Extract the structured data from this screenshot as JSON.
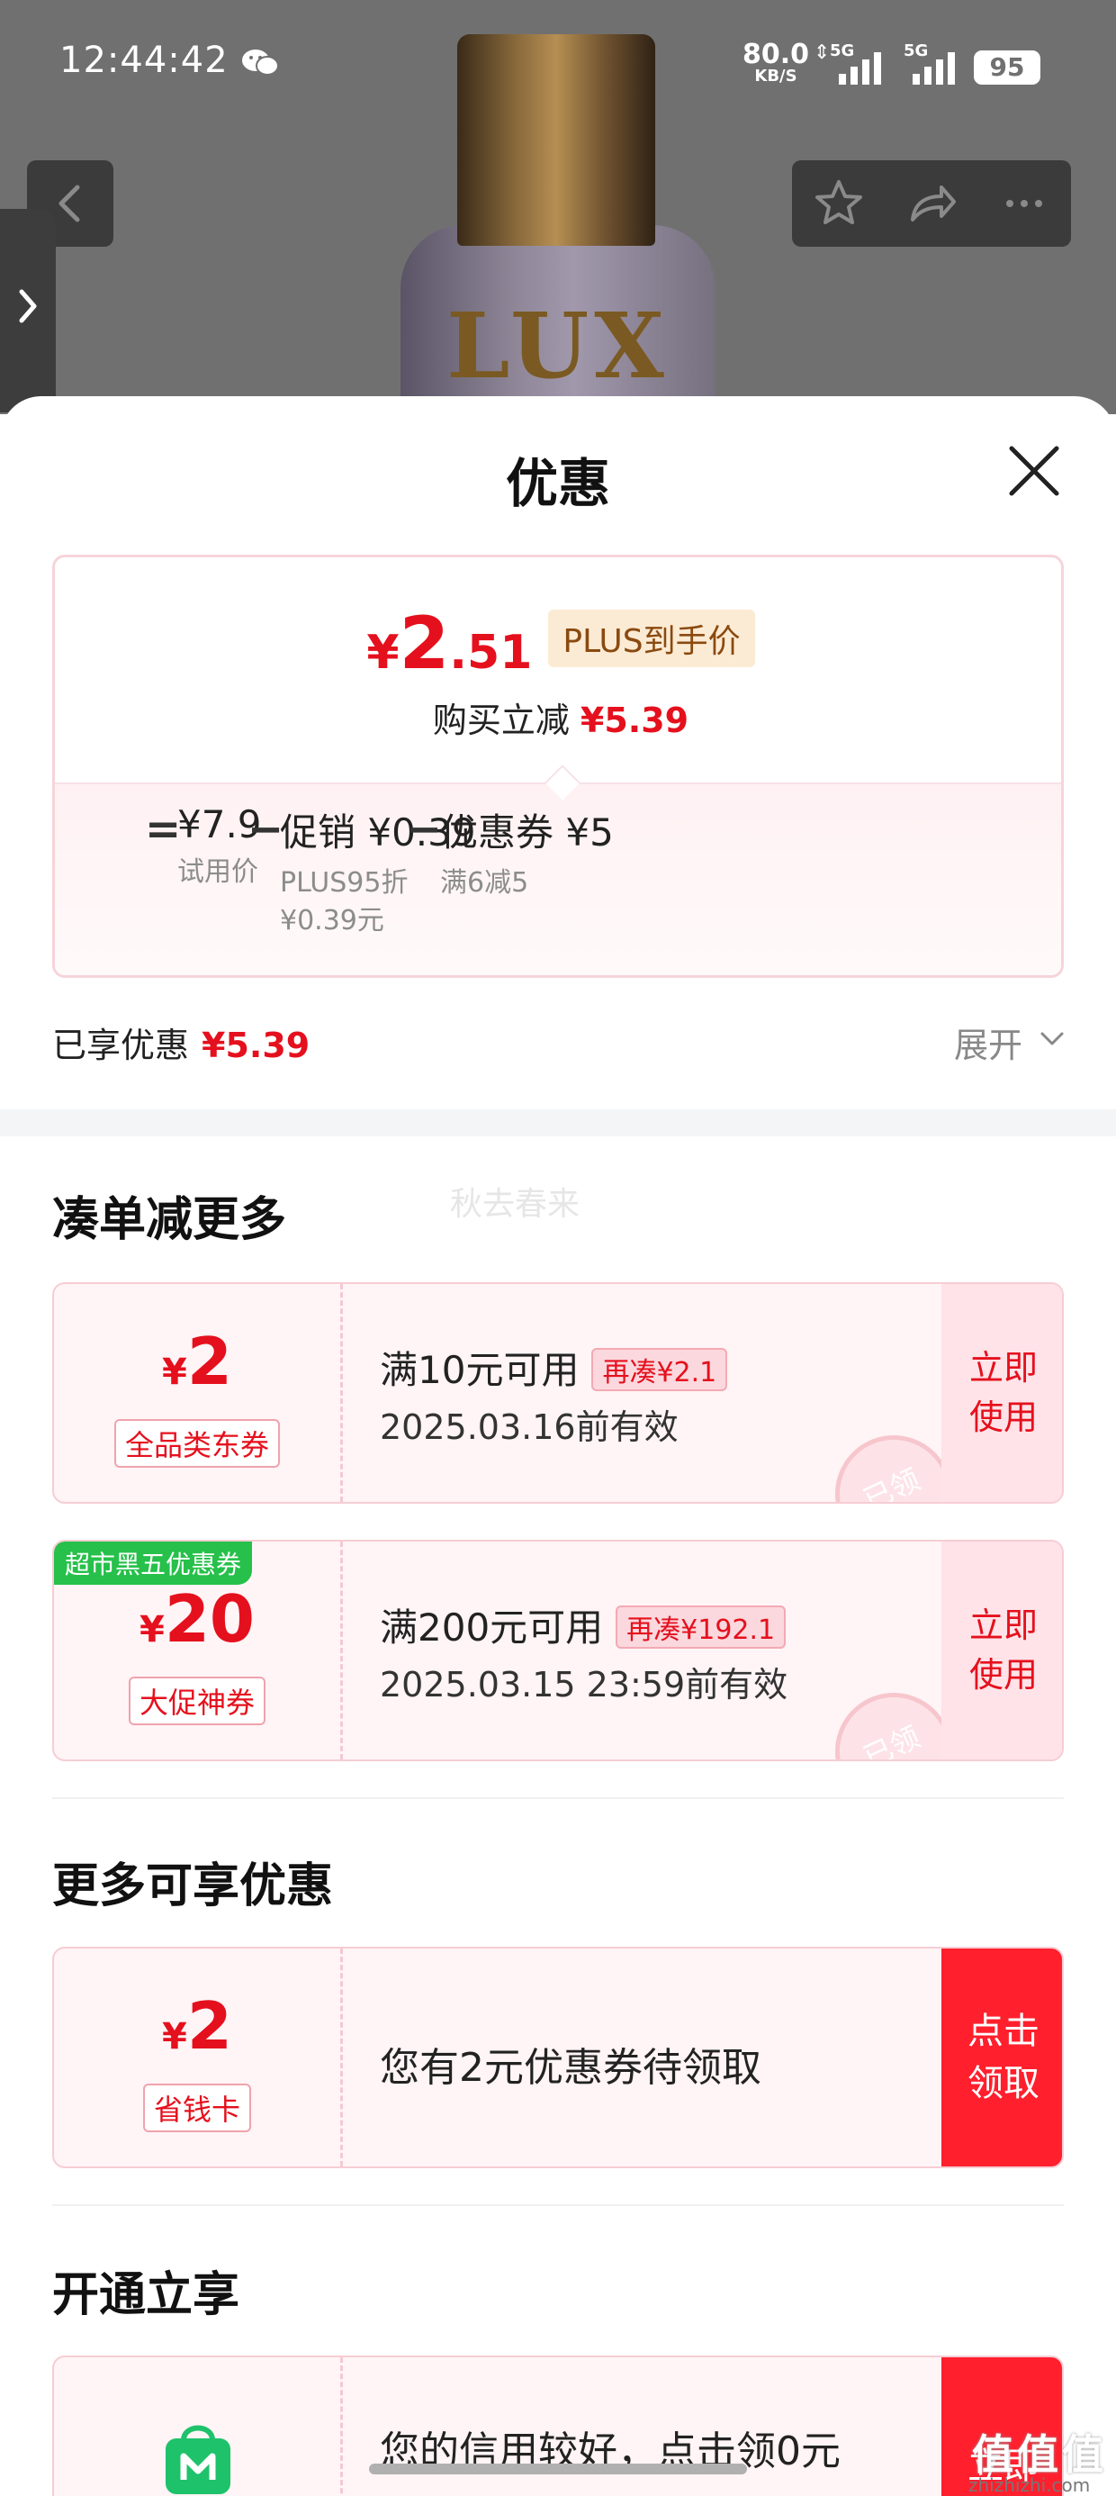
{
  "status_bar": {
    "time": "12:44:42",
    "speed_value": "80.0",
    "speed_unit": "KB/S",
    "network_label_1": "5G",
    "network_label_2": "5G",
    "battery": "95"
  },
  "product": {
    "logo_text": "LUX"
  },
  "sheet": {
    "title": "优惠",
    "price_card": {
      "currency": "¥",
      "price_integer": "2",
      "price_decimal": ".51",
      "plus_tag": "PLUS到手价",
      "instant_cut_label": "购买立减",
      "instant_cut_value": "¥5.39",
      "formula": {
        "equals": "=",
        "base_value": "¥7.9",
        "base_label": "试用价",
        "minus_1": "−",
        "promo_value": "促销 ¥0.39",
        "promo_sub_1": "PLUS95折",
        "promo_sub_2": "¥0.39元",
        "minus_2": "−",
        "coupon_value": "优惠券 ¥5",
        "coupon_sub": "满6减5"
      }
    },
    "enjoyed_label": "已享优惠",
    "enjoyed_value": "¥5.39",
    "expand_label": "展开",
    "watermark": "秋去春来",
    "combine_section": {
      "title": "凑单减更多",
      "coupons": [
        {
          "currency": "¥",
          "amount": "2",
          "type": "全品类东券",
          "condition": "满10元可用",
          "add_more": "再凑¥2.1",
          "validity": "2025.03.16前有效",
          "action": "立即使用",
          "stamp": "已领"
        },
        {
          "tag": "超市黑五优惠券",
          "currency": "¥",
          "amount": "20",
          "type": "大促神券",
          "condition": "满200元可用",
          "add_more": "再凑¥192.1",
          "validity": "2025.03.15 23:59前有效",
          "action": "立即使用",
          "stamp": "已领"
        }
      ]
    },
    "more_section": {
      "title": "更多可享优惠",
      "card": {
        "currency": "¥",
        "amount": "2",
        "type": "省钱卡",
        "text": "您有2元优惠券待领取",
        "action": "点击领取"
      }
    },
    "open_section": {
      "title": "开通立享",
      "card": {
        "text": "您的信用较好，点击领0元",
        "action": "立即"
      }
    }
  },
  "corner_logo": "值值值",
  "corner_url": "zhizhizhi.com",
  "colors": {
    "accent_red": "#e5101d",
    "cta_red": "#ff1f2d",
    "plus_tag_bg": "#fcebd4",
    "green_tag": "#26c04a"
  }
}
